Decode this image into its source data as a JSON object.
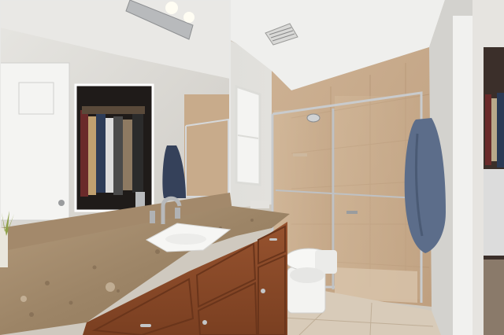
{
  "scene": {
    "kind": "photo",
    "subject": "bathroom",
    "palette": {
      "wall": "#d9d8d4",
      "ceiling": "#eeeeec",
      "tile": "#c9ad8e",
      "granite": "#a88e6f",
      "cabinet": "#8a4a28",
      "floor": "#d8cbb9",
      "towel": "#5c6d8a",
      "chrome": "#c4c6c8"
    },
    "icons": [
      "ceiling-vent-icon",
      "vanity-light-icon",
      "faucet-icon",
      "toilet-icon",
      "towel-icon",
      "shower-head-icon"
    ]
  }
}
